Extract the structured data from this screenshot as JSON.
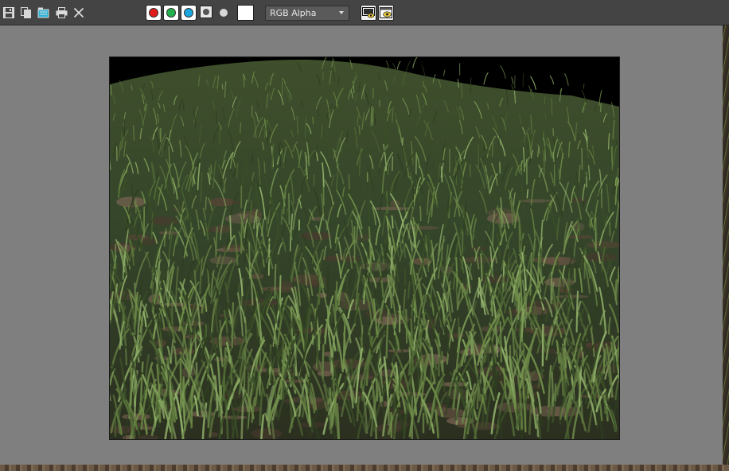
{
  "window": {
    "icons": {
      "save": "save-icon",
      "clone": "clone-icon",
      "clear": "clear-icon",
      "print": "print-icon",
      "close": "close-icon"
    }
  },
  "channels": {
    "red": {
      "icon": "red-channel-icon",
      "color": "#e11b1b"
    },
    "green": {
      "icon": "green-channel-icon",
      "color": "#22b14c"
    },
    "blue": {
      "icon": "blue-channel-icon",
      "color": "#1aa7e0"
    },
    "mono": {
      "icon": "monochrome-icon"
    },
    "alpha": {
      "icon": "alpha-channel-icon"
    },
    "swatch_color": "#ffffff"
  },
  "channel_select": {
    "value": "RGB Alpha"
  },
  "display": {
    "toggle_ui": "display-toggle-icon",
    "view_options": "view-options-icon"
  },
  "colors": {
    "toolbar_bg": "#444444",
    "frame_bg": "#7f7f7f"
  }
}
